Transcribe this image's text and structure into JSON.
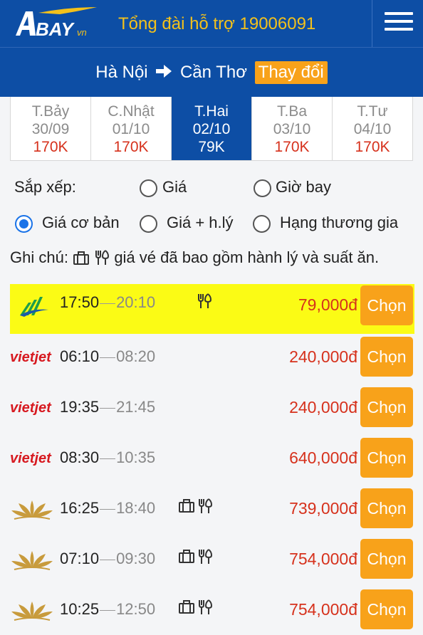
{
  "header": {
    "logo_text": "BAY",
    "logo_suffix": "vn",
    "hotline": "Tổng đài hỗ trợ 19006091"
  },
  "route": {
    "from": "Hà Nội",
    "to": "Cần Thơ",
    "change_label": "Thay đổi"
  },
  "dates": [
    {
      "dow": "T.Bảy",
      "date": "30/09",
      "price": "170K",
      "active": false
    },
    {
      "dow": "C.Nhật",
      "date": "01/10",
      "price": "170K",
      "active": false
    },
    {
      "dow": "T.Hai",
      "date": "02/10",
      "price": "79K",
      "active": true
    },
    {
      "dow": "T.Ba",
      "date": "03/10",
      "price": "170K",
      "active": false
    },
    {
      "dow": "T.Tư",
      "date": "04/10",
      "price": "170K",
      "active": false
    }
  ],
  "sort": {
    "label": "Sắp xếp:",
    "by_price": "Giá",
    "by_time": "Giờ bay"
  },
  "fare_options": {
    "basic": "Giá cơ bản",
    "with_luggage": "Giá + h.lý",
    "business": "Hạng thương gia",
    "selected": "basic"
  },
  "note": {
    "label": "Ghi chú:",
    "text": "giá vé đã bao gồm hành lý và suất ăn."
  },
  "flights": [
    {
      "airline": "bamboo",
      "dep": "17:50",
      "arr": "20:10",
      "luggage": false,
      "meal": true,
      "price": "79,000đ",
      "button": "Chọn",
      "highlight": true
    },
    {
      "airline": "vietjet",
      "dep": "06:10",
      "arr": "08:20",
      "luggage": false,
      "meal": false,
      "price": "240,000đ",
      "button": "Chọn",
      "highlight": false
    },
    {
      "airline": "vietjet",
      "dep": "19:35",
      "arr": "21:45",
      "luggage": false,
      "meal": false,
      "price": "240,000đ",
      "button": "Chọn",
      "highlight": false
    },
    {
      "airline": "vietjet",
      "dep": "08:30",
      "arr": "10:35",
      "luggage": false,
      "meal": false,
      "price": "640,000đ",
      "button": "Chọn",
      "highlight": false
    },
    {
      "airline": "vietnam-airlines",
      "dep": "16:25",
      "arr": "18:40",
      "luggage": true,
      "meal": true,
      "price": "739,000đ",
      "button": "Chọn",
      "highlight": false
    },
    {
      "airline": "vietnam-airlines",
      "dep": "07:10",
      "arr": "09:30",
      "luggage": true,
      "meal": true,
      "price": "754,000đ",
      "button": "Chọn",
      "highlight": false
    },
    {
      "airline": "vietnam-airlines",
      "dep": "10:25",
      "arr": "12:50",
      "luggage": true,
      "meal": true,
      "price": "754,000đ",
      "button": "Chọn",
      "highlight": false
    }
  ],
  "colors": {
    "brand_blue": "#0d4ea5",
    "accent_orange": "#f8a21a",
    "price_red": "#d6311c",
    "highlight_yellow": "#fbfb15"
  }
}
